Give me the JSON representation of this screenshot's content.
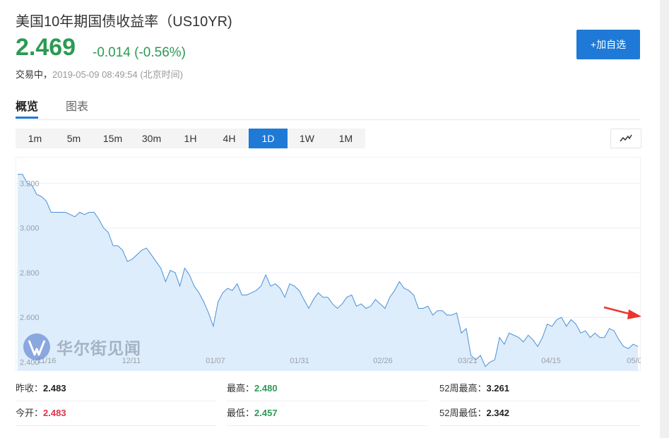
{
  "header": {
    "title": "美国10年期国债收益率（US10YR)",
    "price": "2.469",
    "change": "-0.014 (-0.56%)",
    "status_label": "交易中，",
    "timestamp": "2019-05-09 08:49:54 (北京时间)",
    "add_button_label": "+加自选"
  },
  "tabs": [
    {
      "label": "概览",
      "active": true
    },
    {
      "label": "图表",
      "active": false
    }
  ],
  "ranges": [
    {
      "label": "1m",
      "active": false
    },
    {
      "label": "5m",
      "active": false
    },
    {
      "label": "15m",
      "active": false
    },
    {
      "label": "30m",
      "active": false
    },
    {
      "label": "1H",
      "active": false
    },
    {
      "label": "4H",
      "active": false
    },
    {
      "label": "1D",
      "active": true
    },
    {
      "label": "1W",
      "active": false
    },
    {
      "label": "1M",
      "active": false
    }
  ],
  "chart_type_icon": "line-chart-icon",
  "watermark": {
    "text": "华尔街见闻",
    "icon": "wallstreetcn-logo-icon"
  },
  "chart_data": {
    "type": "area",
    "y_ticks": [
      "3.200",
      "3.000",
      "2.800",
      "2.600",
      "2.400"
    ],
    "y_tick_values": [
      3.2,
      3.0,
      2.8,
      2.6,
      2.4
    ],
    "x_ticks": [
      "11/16",
      "12/11",
      "01/07",
      "01/31",
      "02/26",
      "03/21",
      "04/15",
      "05/0"
    ],
    "ylim": [
      2.37,
      3.28
    ],
    "grid": true,
    "line_color": "#4a90d9",
    "fill_color": "#deedfb",
    "series": [
      {
        "values": [
          3.24,
          3.24,
          3.2,
          3.19,
          3.15,
          3.14,
          3.12,
          3.07,
          3.07,
          3.07,
          3.07,
          3.06,
          3.05,
          3.07,
          3.06,
          3.07,
          3.07,
          3.04,
          3.0,
          2.98,
          2.92,
          2.92,
          2.9,
          2.85,
          2.86,
          2.88,
          2.9,
          2.91,
          2.88,
          2.85,
          2.82,
          2.76,
          2.81,
          2.8,
          2.74,
          2.82,
          2.79,
          2.74,
          2.71,
          2.67,
          2.62,
          2.56,
          2.67,
          2.71,
          2.73,
          2.72,
          2.75,
          2.7,
          2.7,
          2.71,
          2.72,
          2.74,
          2.79,
          2.74,
          2.75,
          2.73,
          2.69,
          2.75,
          2.74,
          2.72,
          2.68,
          2.64,
          2.68,
          2.71,
          2.69,
          2.69,
          2.66,
          2.64,
          2.66,
          2.69,
          2.7,
          2.65,
          2.66,
          2.64,
          2.65,
          2.68,
          2.66,
          2.64,
          2.69,
          2.72,
          2.76,
          2.73,
          2.72,
          2.7,
          2.64,
          2.64,
          2.65,
          2.61,
          2.63,
          2.63,
          2.61,
          2.61,
          2.62,
          2.53,
          2.55,
          2.43,
          2.41,
          2.43,
          2.38,
          2.4,
          2.41,
          2.51,
          2.48,
          2.53,
          2.52,
          2.51,
          2.49,
          2.52,
          2.5,
          2.47,
          2.51,
          2.57,
          2.56,
          2.59,
          2.6,
          2.56,
          2.59,
          2.57,
          2.53,
          2.54,
          2.51,
          2.53,
          2.51,
          2.51,
          2.55,
          2.54,
          2.5,
          2.47,
          2.46,
          2.48,
          2.47
        ]
      }
    ]
  },
  "stats": [
    {
      "label": "昨收：",
      "value": "2.483",
      "tone": "neutral"
    },
    {
      "label": "最高：",
      "value": "2.480",
      "tone": "green"
    },
    {
      "label": "52周最高：",
      "value": "3.261",
      "tone": "neutral"
    },
    {
      "label": "今开：",
      "value": "2.483",
      "tone": "red"
    },
    {
      "label": "最低：",
      "value": "2.457",
      "tone": "green"
    },
    {
      "label": "52周最低：",
      "value": "2.342",
      "tone": "neutral"
    }
  ]
}
